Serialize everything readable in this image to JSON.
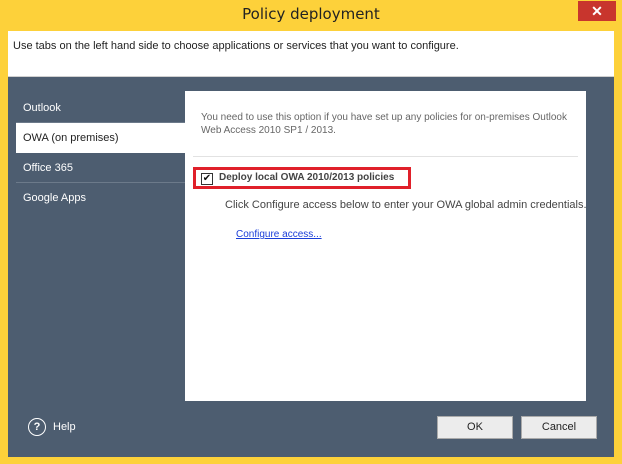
{
  "window": {
    "title": "Policy deployment",
    "close_glyph": "✕"
  },
  "header": {
    "text": "Use tabs on the left hand side to choose applications or services that you want to configure."
  },
  "tabs": [
    {
      "label": "Outlook",
      "selected": false
    },
    {
      "label": "OWA (on premises)",
      "selected": true
    },
    {
      "label": "Office 365",
      "selected": false
    },
    {
      "label": "Google Apps",
      "selected": false
    }
  ],
  "panel": {
    "note": "You need to use this option if you have set up any policies for on-premises Outlook Web Access 2010 SP1 / 2013.",
    "checkbox_label": "Deploy local OWA 2010/2013 policies",
    "checkbox_checked": true,
    "checkbox_mark": "✔",
    "instructions": "Click Configure access below to enter your OWA global admin credentials.",
    "configure_link": "Configure access..."
  },
  "footer": {
    "help_label": "Help",
    "help_glyph": "?",
    "ok_label": "OK",
    "cancel_label": "Cancel"
  },
  "colors": {
    "titlebar": "#fdd13a",
    "background": "#4d5d70",
    "highlight": "#e0202a",
    "close": "#c8352d",
    "link": "#1a3ed8"
  }
}
